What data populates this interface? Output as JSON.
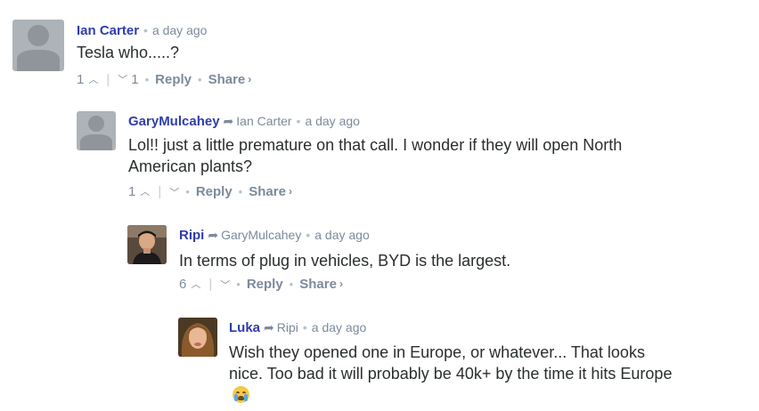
{
  "comments": [
    {
      "author": "Ian Carter",
      "reply_to": "",
      "time": "a day ago",
      "text": "Tesla who.....?",
      "upvotes": "1",
      "downvotes": "1",
      "reply_label": "Reply",
      "share_label": "Share",
      "avatar": "default-avatar"
    },
    {
      "author": "GaryMulcahey",
      "reply_to": "Ian Carter",
      "time": "a day ago",
      "text": "Lol!! just a little premature on that call. I wonder if they will open North American plants?",
      "upvotes": "1",
      "downvotes": "",
      "reply_label": "Reply",
      "share_label": "Share",
      "avatar": "default-avatar"
    },
    {
      "author": "Ripi",
      "reply_to": "GaryMulcahey",
      "time": "a day ago",
      "text": "In terms of plug in vehicles, BYD is the largest.",
      "upvotes": "6",
      "downvotes": "",
      "reply_label": "Reply",
      "share_label": "Share",
      "avatar": "photo-avatar"
    },
    {
      "author": "Luka",
      "reply_to": "Ripi",
      "time": "a day ago",
      "text": "Wish they opened one in Europe, or whatever... That looks nice. Too bad it will probably be 40k+ by the time it hits Europe",
      "emoji": "crying-face-emoji",
      "avatar": "photo-avatar"
    }
  ],
  "colors": {
    "author": "#2f3cad",
    "meta": "#7c8a9c",
    "text": "#2a2e2e",
    "default_avatar_bg": "#aeb3b8"
  }
}
